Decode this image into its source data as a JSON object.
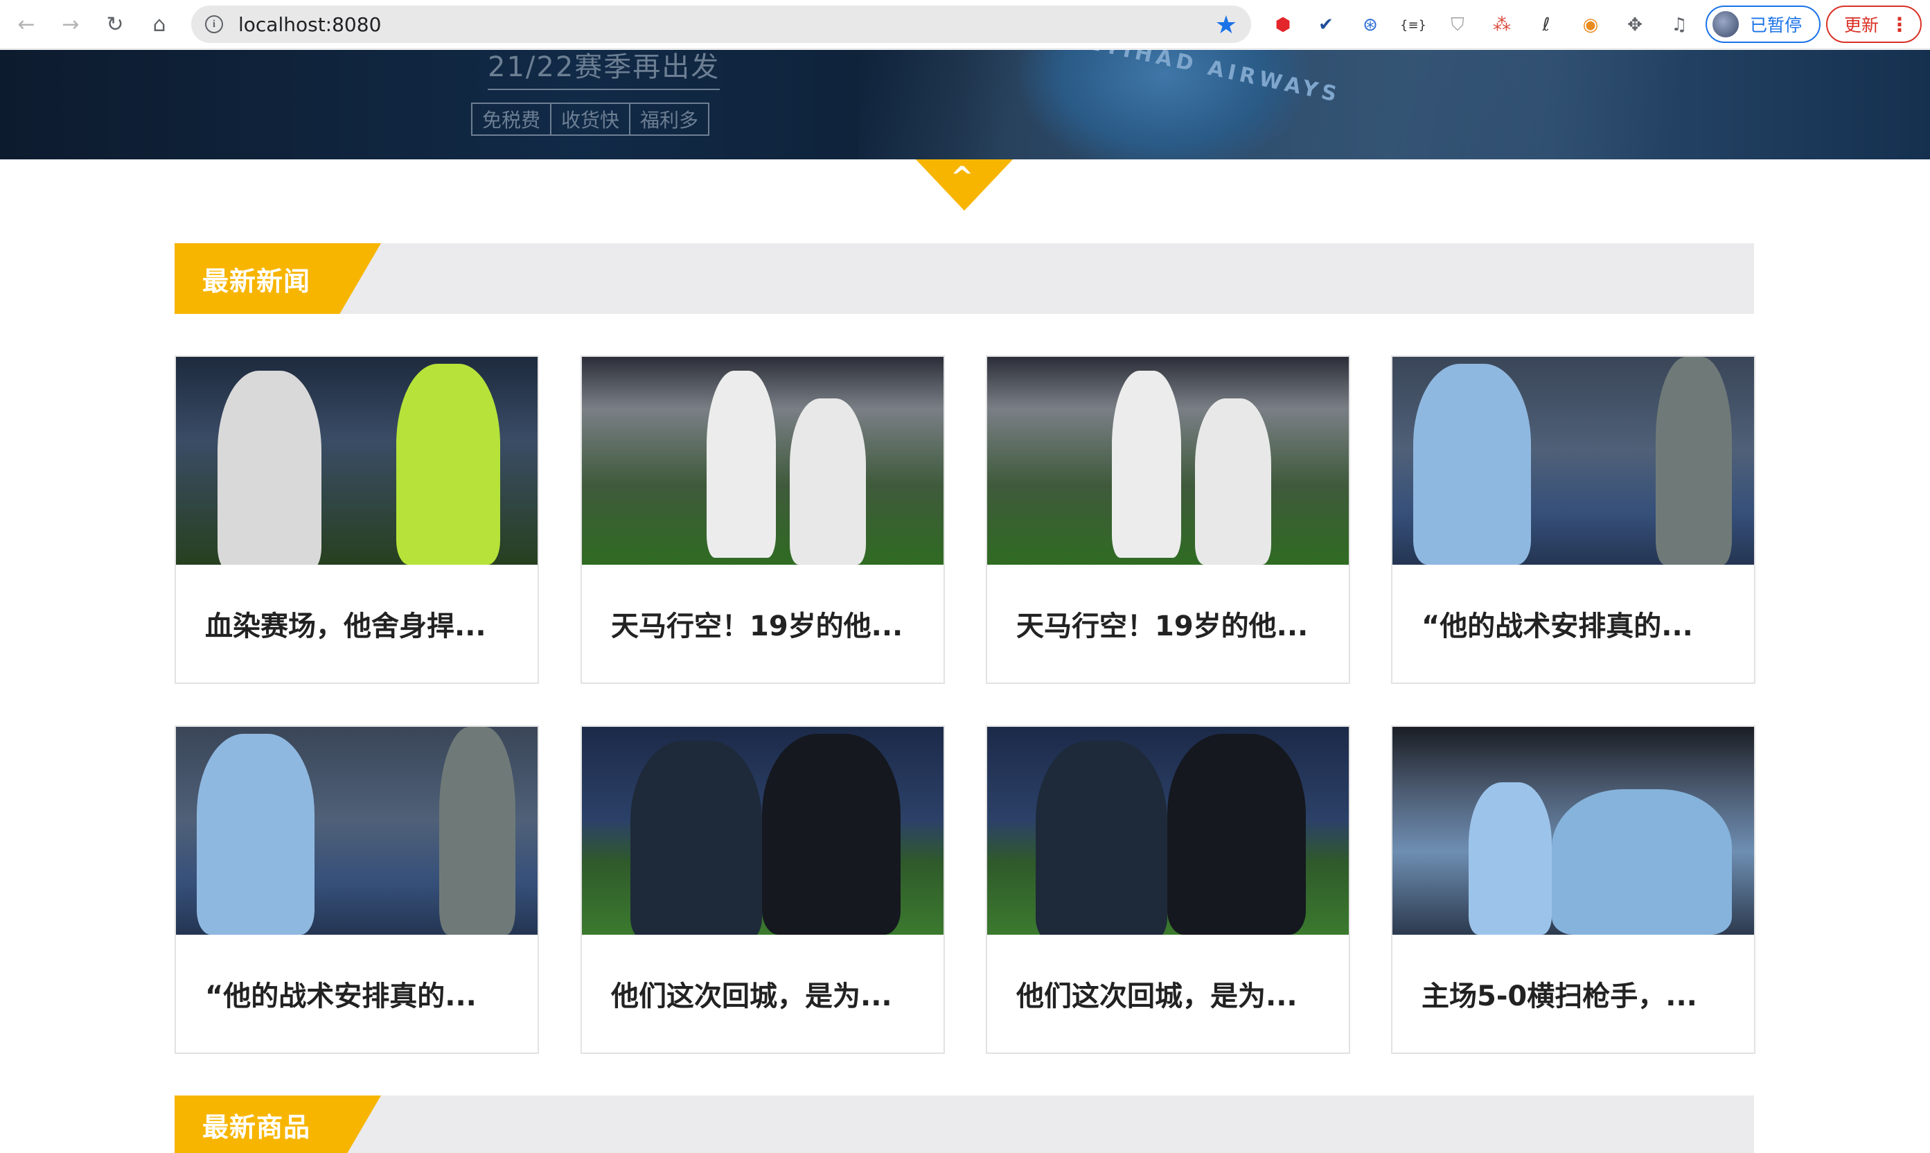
{
  "browser": {
    "url": "localhost:8080",
    "profile_status": "已暂停",
    "update_label": "更新",
    "extensions": [
      "adblock-icon",
      "checkmark-shield-icon",
      "translate-icon",
      "json-icon",
      "shield-outline-icon",
      "network-icon",
      "leaf-icon",
      "chrome-circle-icon",
      "puzzle-icon",
      "media-queue-icon"
    ]
  },
  "banner": {
    "title": "21/22赛季再出发",
    "tags": [
      "免税费",
      "收货快",
      "福利多"
    ],
    "logo_text": "ETIHAD AIRWAYS"
  },
  "sections": [
    {
      "title": "最新新闻"
    },
    {
      "title": "最新商品"
    }
  ],
  "news": [
    {
      "title": "血染赛场，他舍身捍..."
    },
    {
      "title": "天马行空！19岁的他..."
    },
    {
      "title": "天马行空！19岁的他..."
    },
    {
      "title": "“他的战术安排真的..."
    },
    {
      "title": "“他的战术安排真的..."
    },
    {
      "title": "他们这次回城，是为..."
    },
    {
      "title": "他们这次回城，是为..."
    },
    {
      "title": "主场5-0横扫枪手，..."
    }
  ],
  "colors": {
    "accent": "#f7b500",
    "section_bar": "#ebebee",
    "link_blue": "#1a73e8",
    "alert_red": "#d93025"
  }
}
